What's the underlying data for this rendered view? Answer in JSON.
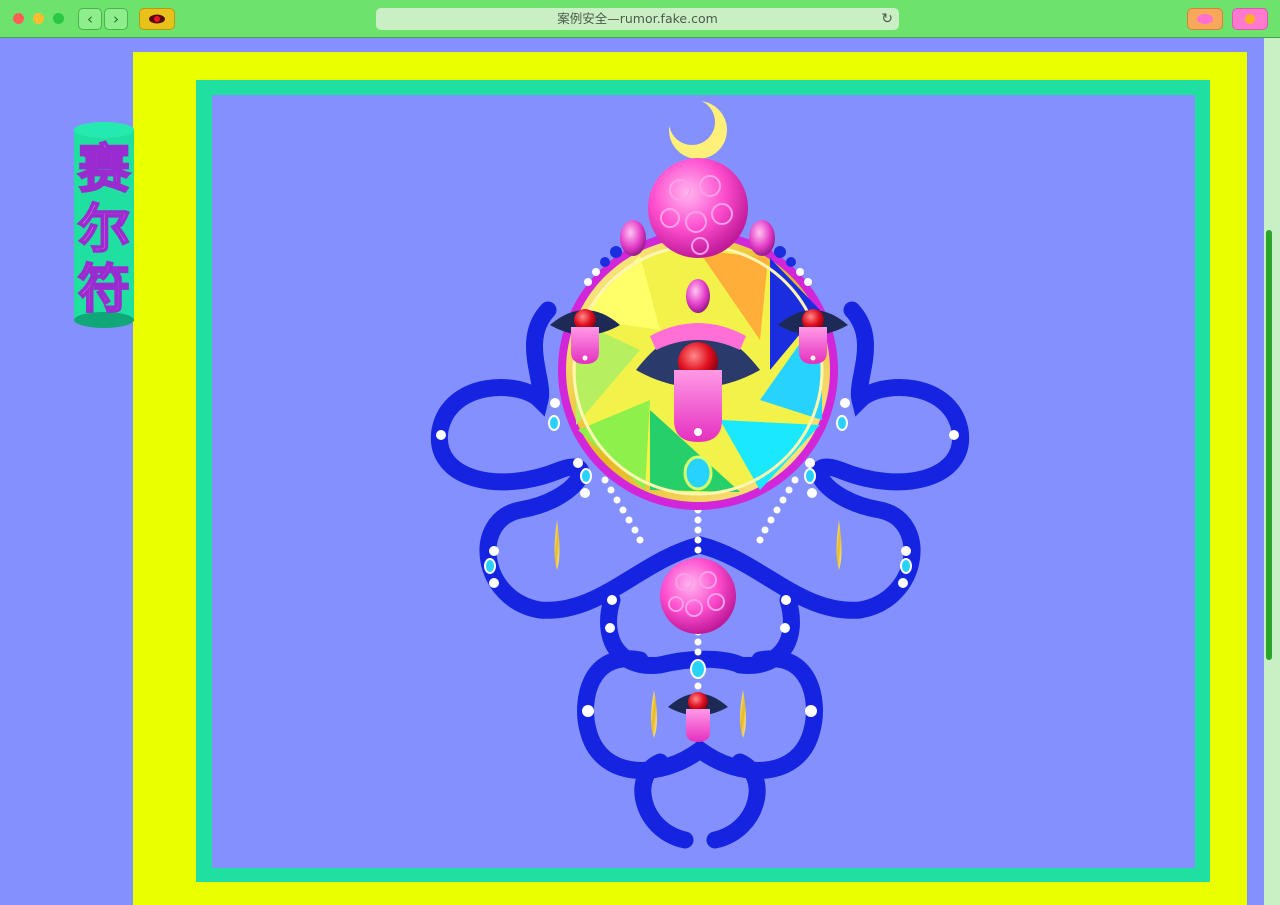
{
  "browser": {
    "url": "案例安全—rumor.fake.com",
    "back_icon": "‹",
    "forward_icon": "›",
    "reload_icon": "↻",
    "extension_icons": [
      "eye-icon",
      "lips-icon",
      "sun-icon"
    ]
  },
  "page": {
    "title_chars": [
      "赛",
      "尔",
      "符"
    ]
  },
  "colors": {
    "background": "#8590ff",
    "browser_bar": "#6de36d",
    "outer_frame": "#eaff00",
    "inner_frame": "#1fe0a0",
    "title_text": "#ff7ae0"
  }
}
